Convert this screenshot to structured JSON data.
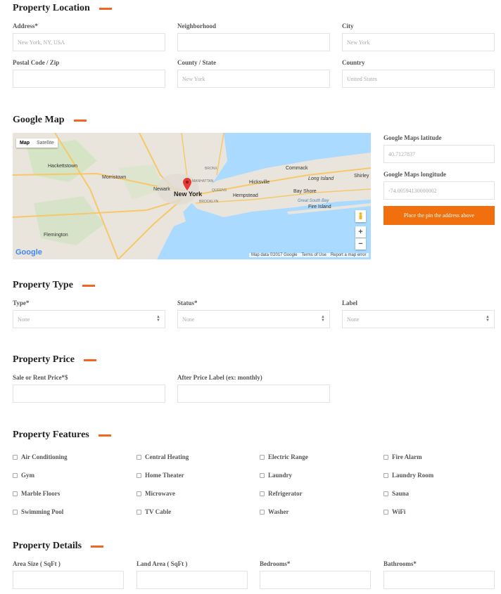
{
  "location": {
    "title": "Property Location",
    "address": {
      "label": "Address*",
      "placeholder": "New York, NY, USA"
    },
    "neighborhood": {
      "label": "Neighborhood",
      "placeholder": ""
    },
    "city": {
      "label": "City",
      "placeholder": "New York"
    },
    "postal": {
      "label": "Postal Code / Zip",
      "placeholder": ""
    },
    "county": {
      "label": "County / State",
      "placeholder": "New York"
    },
    "country": {
      "label": "Country",
      "placeholder": "United States"
    }
  },
  "map": {
    "title": "Google Map",
    "toggle": {
      "map": "Map",
      "satellite": "Satellite"
    },
    "labels": {
      "hackettstown": "Hackettstown",
      "morristown": "Morristown",
      "newark": "Newark",
      "new_york": "New York",
      "hicksville": "Hicksville",
      "commack": "Commack",
      "long_island": "Long Island",
      "shirley": "Shirley",
      "hempstead": "Hempstead",
      "bay_shore": "Bay Shore",
      "fire_island": "Fire Island",
      "great_south_bay": "Great South Bay",
      "flemington": "Flemington",
      "queens": "QUEENS",
      "brooklyn": "BROOKLYN",
      "manhattan": "MANHATTAN",
      "bronx": "BRONX"
    },
    "logo": "Google",
    "footer": {
      "data": "Map data ©2017 Google",
      "terms": "Terms of Use",
      "report": "Report a map error"
    },
    "zoom_in": "+",
    "zoom_out": "−",
    "latitude": {
      "label": "Google Maps latitude",
      "value": "40.7127837"
    },
    "longitude": {
      "label": "Google Maps longitude",
      "value": "-74.00594130000002"
    },
    "button": "Place the pin the address above"
  },
  "type": {
    "title": "Property Type",
    "type": {
      "label": "Type*",
      "value": "None"
    },
    "status": {
      "label": "Status*",
      "value": "None"
    },
    "label": {
      "label": "Label",
      "value": "None"
    }
  },
  "price": {
    "title": "Property Price",
    "sale": {
      "label": "Sale or Rent Price*$"
    },
    "after": {
      "label": "After Price Label (ex: monthly)"
    }
  },
  "features": {
    "title": "Property Features",
    "items": [
      "Air Conditioning",
      "Central Heating",
      "Electric Range",
      "Fire Alarm",
      "Gym",
      "Home Theater",
      "Laundry",
      "Laundry Room",
      "Marble Floors",
      "Microwave",
      "Refrigerator",
      "Sauna",
      "Swimming Pool",
      "TV Cable",
      "Washer",
      "WiFi"
    ]
  },
  "details": {
    "title": "Property Details",
    "area": {
      "label": "Area Size ( SqFt )"
    },
    "land": {
      "label": "Land Area ( SqFt )"
    },
    "bedrooms": {
      "label": "Bedrooms*"
    },
    "bathrooms": {
      "label": "Bathrooms*"
    }
  },
  "colors": {
    "accent": "#f26522",
    "button": "#f26f0d",
    "water": "#aadaff",
    "land": "#e9e5dc"
  }
}
